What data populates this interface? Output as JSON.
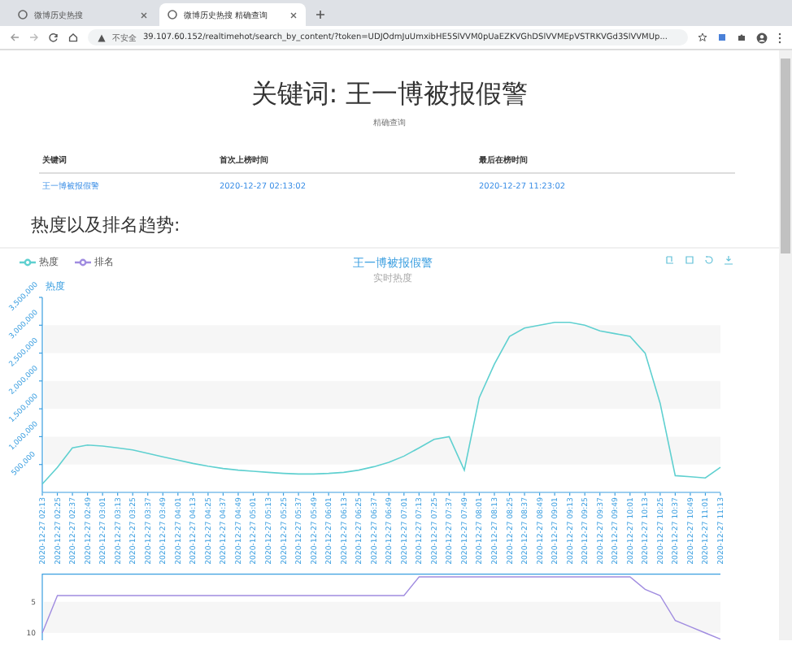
{
  "browser": {
    "tabs": [
      {
        "title": "微博历史热搜",
        "selected": false
      },
      {
        "title": "微博历史热搜 精确查询",
        "selected": true
      }
    ],
    "security": "不安全",
    "url": "39.107.60.152/realtimehot/search_by_content/?token=UDJOdmJuUmxibHE5SlVVM0pUaEZKVGhDSlVVMEpVSTRKVGd3SlVVMUp..."
  },
  "page": {
    "title": "关键词: 王一博被报假警",
    "subtitle": "精确查询",
    "table": {
      "columns": [
        "关键词",
        "首次上榜时间",
        "最后在榜时间"
      ],
      "rows": [
        [
          "王一博被报假警",
          "2020-12-27 02:13:02",
          "2020-12-27 11:23:02"
        ]
      ]
    },
    "section_title": "热度以及排名趋势:",
    "chart_panel": {
      "legend": [
        {
          "name": "热度",
          "color": "#5fd0d0"
        },
        {
          "name": "排名",
          "color": "#a08ce0"
        }
      ],
      "title": "王一博被报假警",
      "subtitle": "实时热度",
      "heat_chart": {
        "chart_data": {
          "type": "line",
          "ylabel": "热度",
          "categories": [
            "2020-12-27 02:13",
            "2020-12-27 02:25",
            "2020-12-27 02:37",
            "2020-12-27 02:49",
            "2020-12-27 03:01",
            "2020-12-27 03:13",
            "2020-12-27 03:25",
            "2020-12-27 03:37",
            "2020-12-27 03:49",
            "2020-12-27 04:01",
            "2020-12-27 04:13",
            "2020-12-27 04:25",
            "2020-12-27 04:37",
            "2020-12-27 04:49",
            "2020-12-27 05:01",
            "2020-12-27 05:13",
            "2020-12-27 05:25",
            "2020-12-27 05:37",
            "2020-12-27 05:49",
            "2020-12-27 06:01",
            "2020-12-27 06:13",
            "2020-12-27 06:25",
            "2020-12-27 06:37",
            "2020-12-27 06:49",
            "2020-12-27 07:01",
            "2020-12-27 07:13",
            "2020-12-27 07:25",
            "2020-12-27 07:37",
            "2020-12-27 07:49",
            "2020-12-27 08:01",
            "2020-12-27 08:13",
            "2020-12-27 08:25",
            "2020-12-27 08:37",
            "2020-12-27 08:49",
            "2020-12-27 09:01",
            "2020-12-27 09:13",
            "2020-12-27 09:25",
            "2020-12-27 09:37",
            "2020-12-27 09:49",
            "2020-12-27 10:01",
            "2020-12-27 10:13",
            "2020-12-27 10:25",
            "2020-12-27 10:37",
            "2020-12-27 10:49",
            "2020-12-27 11:01",
            "2020-12-27 11:13"
          ],
          "values": [
            150000,
            450000,
            800000,
            850000,
            830000,
            800000,
            760000,
            700000,
            640000,
            580000,
            520000,
            470000,
            430000,
            400000,
            380000,
            360000,
            340000,
            330000,
            330000,
            340000,
            360000,
            400000,
            460000,
            540000,
            650000,
            800000,
            950000,
            1000000,
            400000,
            1700000,
            2300000,
            2800000,
            2950000,
            3000000,
            3050000,
            3050000,
            3000000,
            2900000,
            2850000,
            2800000,
            2500000,
            1600000,
            300000,
            280000,
            260000,
            450000
          ],
          "ylim": [
            0,
            3500000
          ],
          "yticks": [
            {
              "value": 500000,
              "label": "500,000"
            },
            {
              "value": 1000000,
              "label": "1,000,000"
            },
            {
              "value": 1500000,
              "label": "1,500,000"
            },
            {
              "value": 2000000,
              "label": "2,000,000"
            },
            {
              "value": 2500000,
              "label": "2,500,000"
            },
            {
              "value": 3000000,
              "label": "3,000,000"
            },
            {
              "value": 3500000,
              "label": "3,500,000"
            }
          ]
        }
      },
      "rank_chart": {
        "y_tick_labels": [
          "5",
          "10"
        ]
      }
    }
  }
}
